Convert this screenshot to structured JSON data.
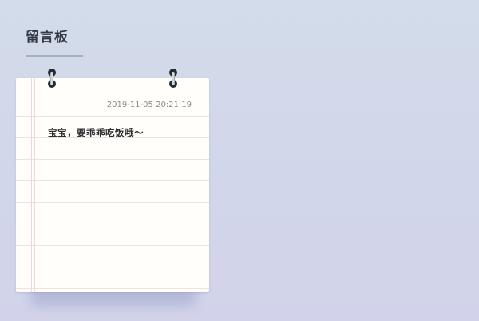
{
  "header": {
    "title": "留言板"
  },
  "note": {
    "timestamp": "2019-11-05 20:21:19",
    "content": "宝宝，要乖乖吃饭哦～"
  },
  "colors": {
    "background": "#d3dcea",
    "paper": "#fffefb",
    "title_text": "#333a45",
    "timestamp_text": "#8c8c8c"
  },
  "icons": [
    "binder-ring-icon",
    "binder-ring-icon"
  ]
}
